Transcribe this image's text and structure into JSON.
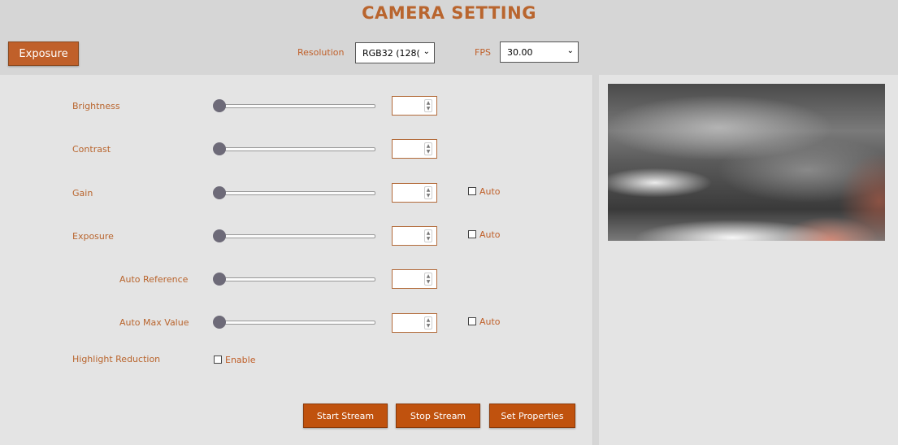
{
  "header": {
    "title": "CAMERA SETTING",
    "tab_label": "Exposure",
    "resolution_label": "Resolution",
    "resolution_value": "RGB32 (128(",
    "fps_label": "FPS",
    "fps_value": "30.00"
  },
  "controls": {
    "brightness": {
      "label": "Brightness",
      "value": ""
    },
    "contrast": {
      "label": "Contrast",
      "value": ""
    },
    "gain": {
      "label": "Gain",
      "value": "",
      "auto_label": "Auto",
      "auto_checked": false
    },
    "exposure": {
      "label": "Exposure",
      "value": "",
      "auto_label": "Auto",
      "auto_checked": false
    },
    "auto_reference": {
      "label": "Auto Reference",
      "value": ""
    },
    "auto_max_value": {
      "label": "Auto Max Value",
      "value": "",
      "auto_label": "Auto",
      "auto_checked": false
    },
    "highlight_reduction": {
      "label": "Highlight Reduction",
      "enable_label": "Enable",
      "checked": false
    }
  },
  "actions": {
    "start_stream": "Start Stream",
    "stop_stream": "Stop Stream",
    "set_properties": "Set Properties"
  },
  "colors": {
    "accent": "#c0602a",
    "button": "#c0520e",
    "panel_bg": "#e4e4e4",
    "page_bg": "#d6d6d6"
  },
  "icons": {
    "select_chevron": "chevron-down-icon",
    "spin_arrows": "spinner-arrows-icon"
  }
}
